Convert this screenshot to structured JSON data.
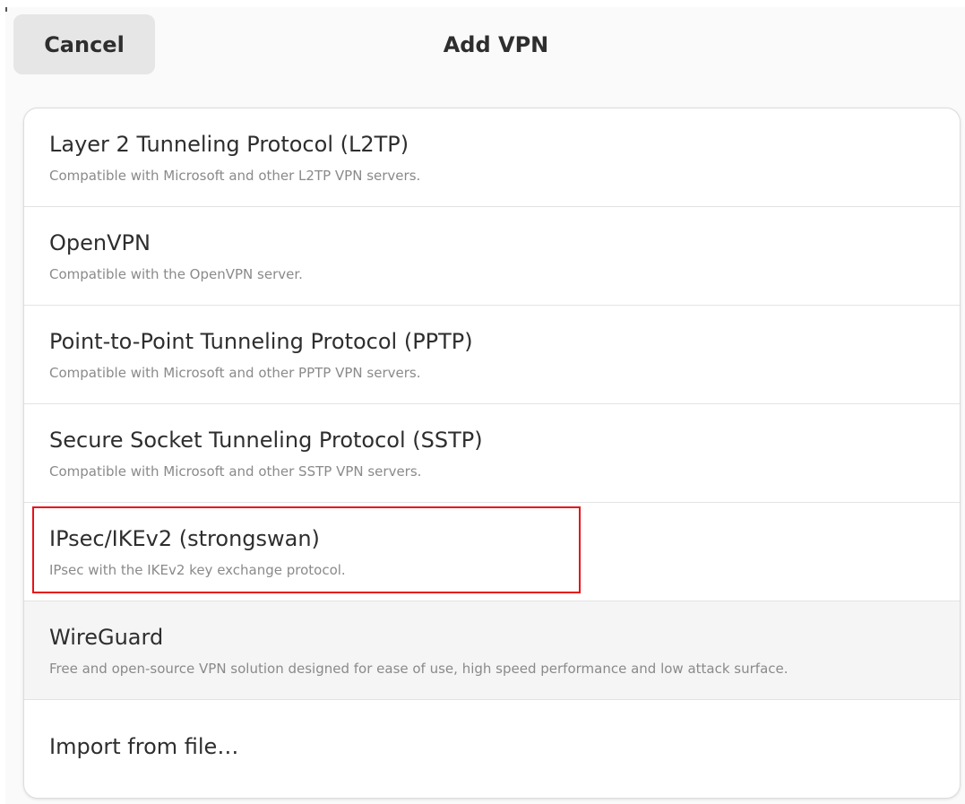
{
  "header": {
    "cancel_label": "Cancel",
    "title": "Add VPN"
  },
  "vpn_types": [
    {
      "title": "Layer 2 Tunneling Protocol (L2TP)",
      "subtitle": "Compatible with Microsoft and other L2TP VPN servers."
    },
    {
      "title": "OpenVPN",
      "subtitle": "Compatible with the OpenVPN server."
    },
    {
      "title": "Point-to-Point Tunneling Protocol (PPTP)",
      "subtitle": "Compatible with Microsoft and other PPTP VPN servers."
    },
    {
      "title": "Secure Socket Tunneling Protocol (SSTP)",
      "subtitle": "Compatible with Microsoft and other SSTP VPN servers."
    },
    {
      "title": "IPsec/IKEv2 (strongswan)",
      "subtitle": "IPsec with the IKEv2 key exchange protocol."
    },
    {
      "title": "WireGuard",
      "subtitle": "Free and open-source VPN solution designed for ease of use, high speed performance and low attack surface."
    }
  ],
  "import_label": "Import from file…",
  "colors": {
    "highlight_border": "#e8101a",
    "hover_row": "#f5f5f5"
  }
}
